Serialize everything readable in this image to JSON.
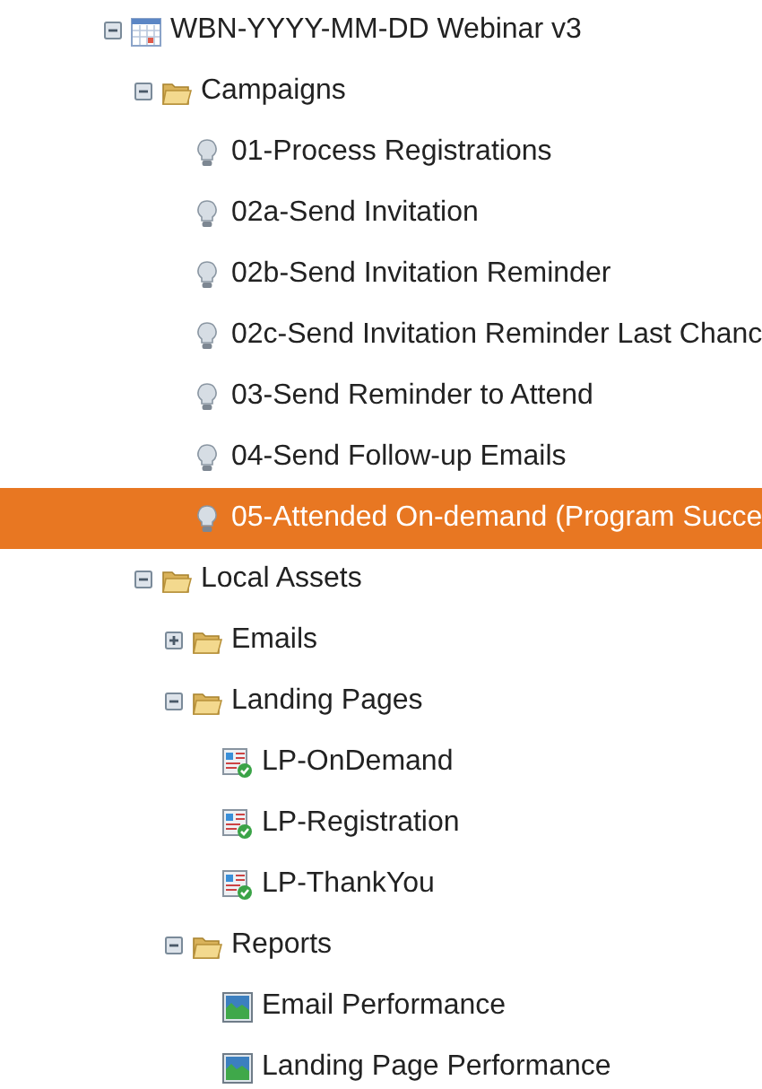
{
  "tree": [
    {
      "label": "WBN-YYYY-MM-DD Webinar v3",
      "kind": "program",
      "expanded": true,
      "selected": false,
      "children": [
        {
          "label": "Campaigns",
          "kind": "folder",
          "expanded": true,
          "selected": false,
          "children": [
            {
              "label": "01-Process Registrations",
              "kind": "campaign",
              "selected": false
            },
            {
              "label": "02a-Send Invitation",
              "kind": "campaign",
              "selected": false
            },
            {
              "label": "02b-Send Invitation Reminder",
              "kind": "campaign",
              "selected": false
            },
            {
              "label": "02c-Send Invitation Reminder Last Chanc",
              "kind": "campaign",
              "selected": false
            },
            {
              "label": "03-Send Reminder to Attend",
              "kind": "campaign",
              "selected": false
            },
            {
              "label": "04-Send Follow-up Emails",
              "kind": "campaign",
              "selected": false
            },
            {
              "label": "05-Attended On-demand (Program Succe",
              "kind": "campaign",
              "selected": true
            }
          ]
        },
        {
          "label": "Local Assets",
          "kind": "folder",
          "expanded": true,
          "selected": false,
          "children": [
            {
              "label": "Emails",
              "kind": "folder",
              "expanded": false,
              "selected": false
            },
            {
              "label": "Landing Pages",
              "kind": "folder",
              "expanded": true,
              "selected": false,
              "children": [
                {
                  "label": "LP-OnDemand",
                  "kind": "landing-page",
                  "selected": false
                },
                {
                  "label": "LP-Registration",
                  "kind": "landing-page",
                  "selected": false
                },
                {
                  "label": "LP-ThankYou",
                  "kind": "landing-page",
                  "selected": false
                }
              ]
            },
            {
              "label": "Reports",
              "kind": "folder",
              "expanded": true,
              "selected": false,
              "children": [
                {
                  "label": "Email Performance",
                  "kind": "report",
                  "selected": false
                },
                {
                  "label": "Landing Page Performance",
                  "kind": "report",
                  "selected": false
                }
              ]
            }
          ]
        }
      ]
    }
  ]
}
